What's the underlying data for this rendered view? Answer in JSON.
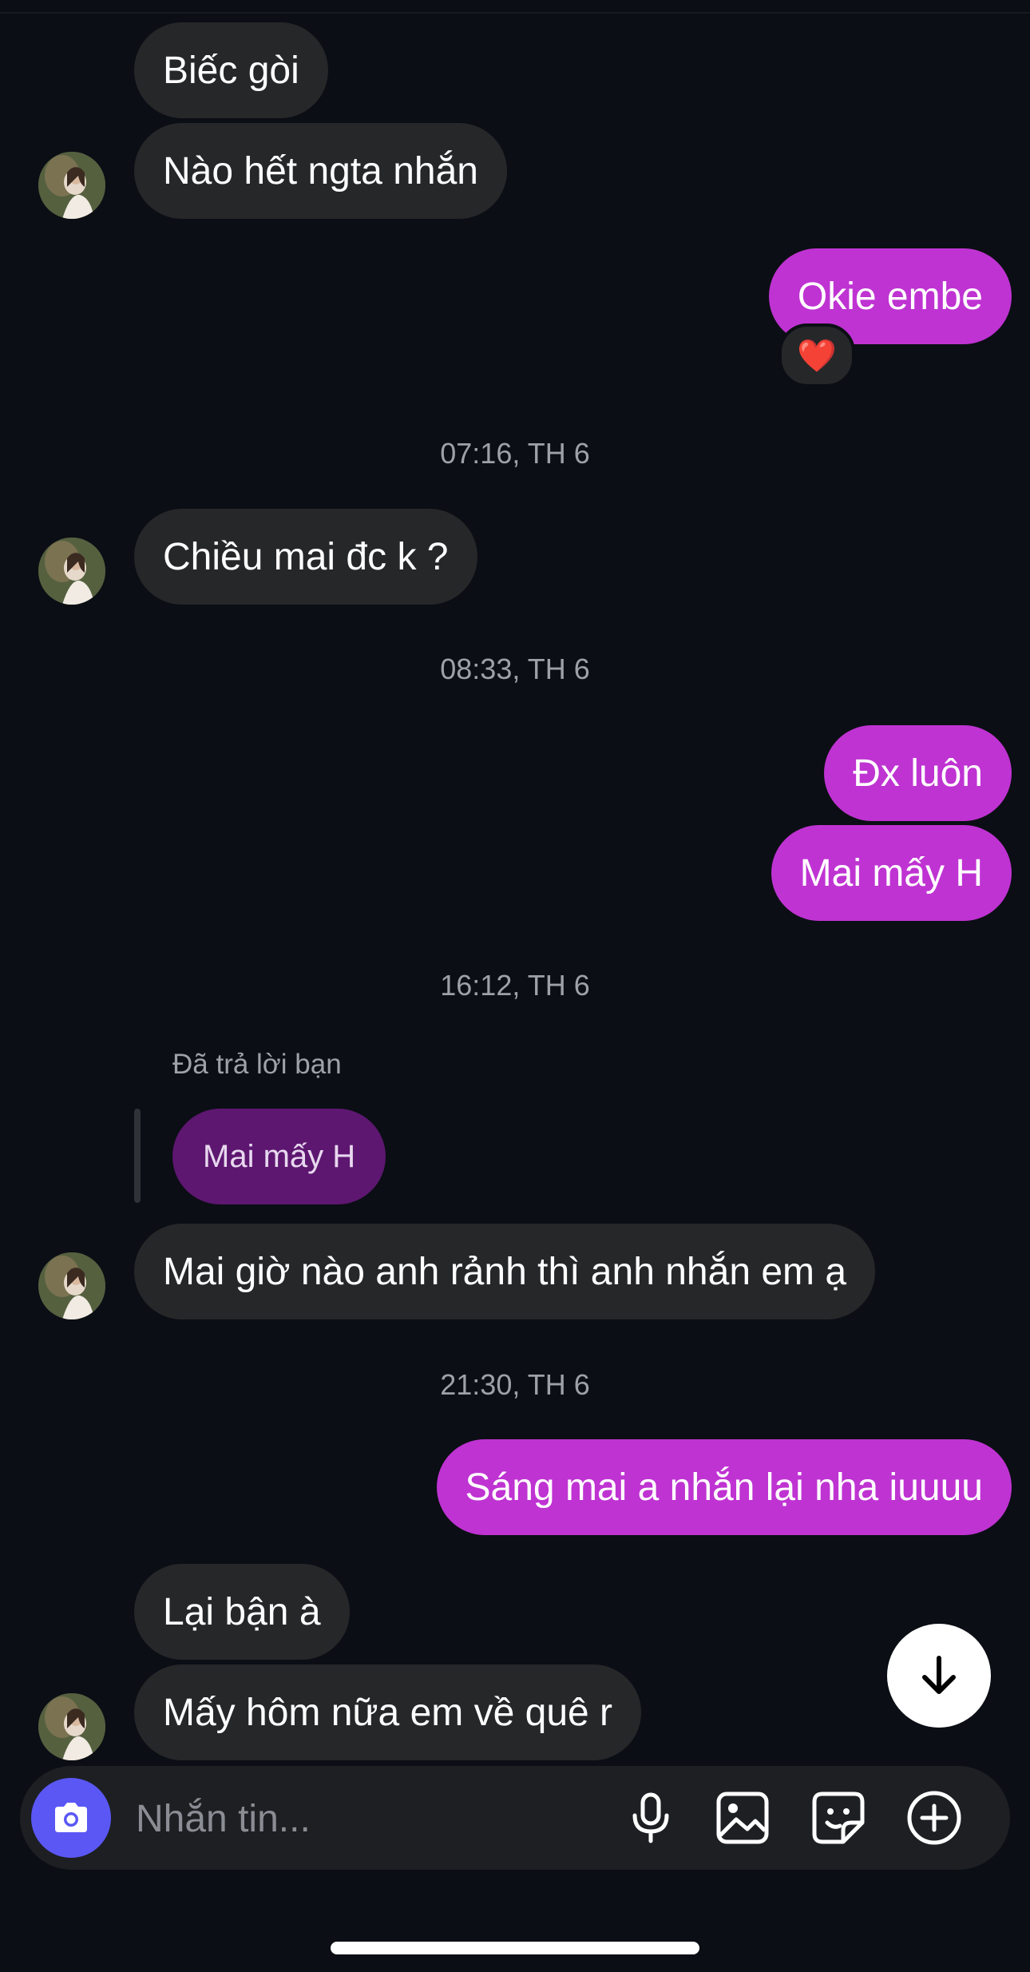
{
  "messages": {
    "m1": "Biếc gòi",
    "m2": "Nào hết ngta nhắn",
    "m3": "Okie embe",
    "m3_reaction": "❤️",
    "m4": "Chiều mai đc k ?",
    "m5": "Đx luôn",
    "m6": "Mai mấy H",
    "m7": "Mai giờ nào anh rảnh thì anh nhắn em ạ",
    "m8": "Sáng mai a nhắn lại nha iuuuu",
    "m9": "Lại bận à",
    "m10": "Mấy hôm nữa em về quê r"
  },
  "timestamps": {
    "t1": "07:16, TH 6",
    "t2": "08:33, TH 6",
    "t3": "16:12, TH 6",
    "t4": "21:30, TH 6"
  },
  "reply": {
    "label": "Đã trả lời bạn",
    "quoted": "Mai mấy H"
  },
  "composer": {
    "placeholder": "Nhắn tin..."
  },
  "icons": {
    "camera": "camera-icon",
    "mic": "microphone-icon",
    "gallery": "image-icon",
    "sticker": "sticker-icon",
    "more": "plus-circle-icon",
    "scroll": "arrow-down-icon"
  },
  "colors": {
    "background": "#0b0e14",
    "incoming_bubble": "#262729",
    "outgoing_bubble": "#bf33d2",
    "reply_bubble": "#5d1770",
    "camera_button": "#5b57f5"
  }
}
